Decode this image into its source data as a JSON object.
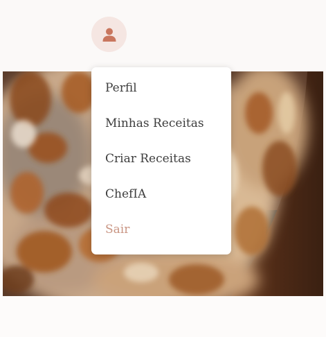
{
  "header": {
    "avatar_icon": "user-icon",
    "avatar_color": "#c9765e",
    "avatar_bg": "#f5e6e2"
  },
  "hero": {
    "image": "food-photo"
  },
  "menu": {
    "items": [
      {
        "label": "Perfil"
      },
      {
        "label": "Minhas Receitas"
      },
      {
        "label": "Criar Receitas"
      },
      {
        "label": "ChefIA"
      },
      {
        "label": "Sair"
      }
    ],
    "logout_color": "#c99583"
  }
}
